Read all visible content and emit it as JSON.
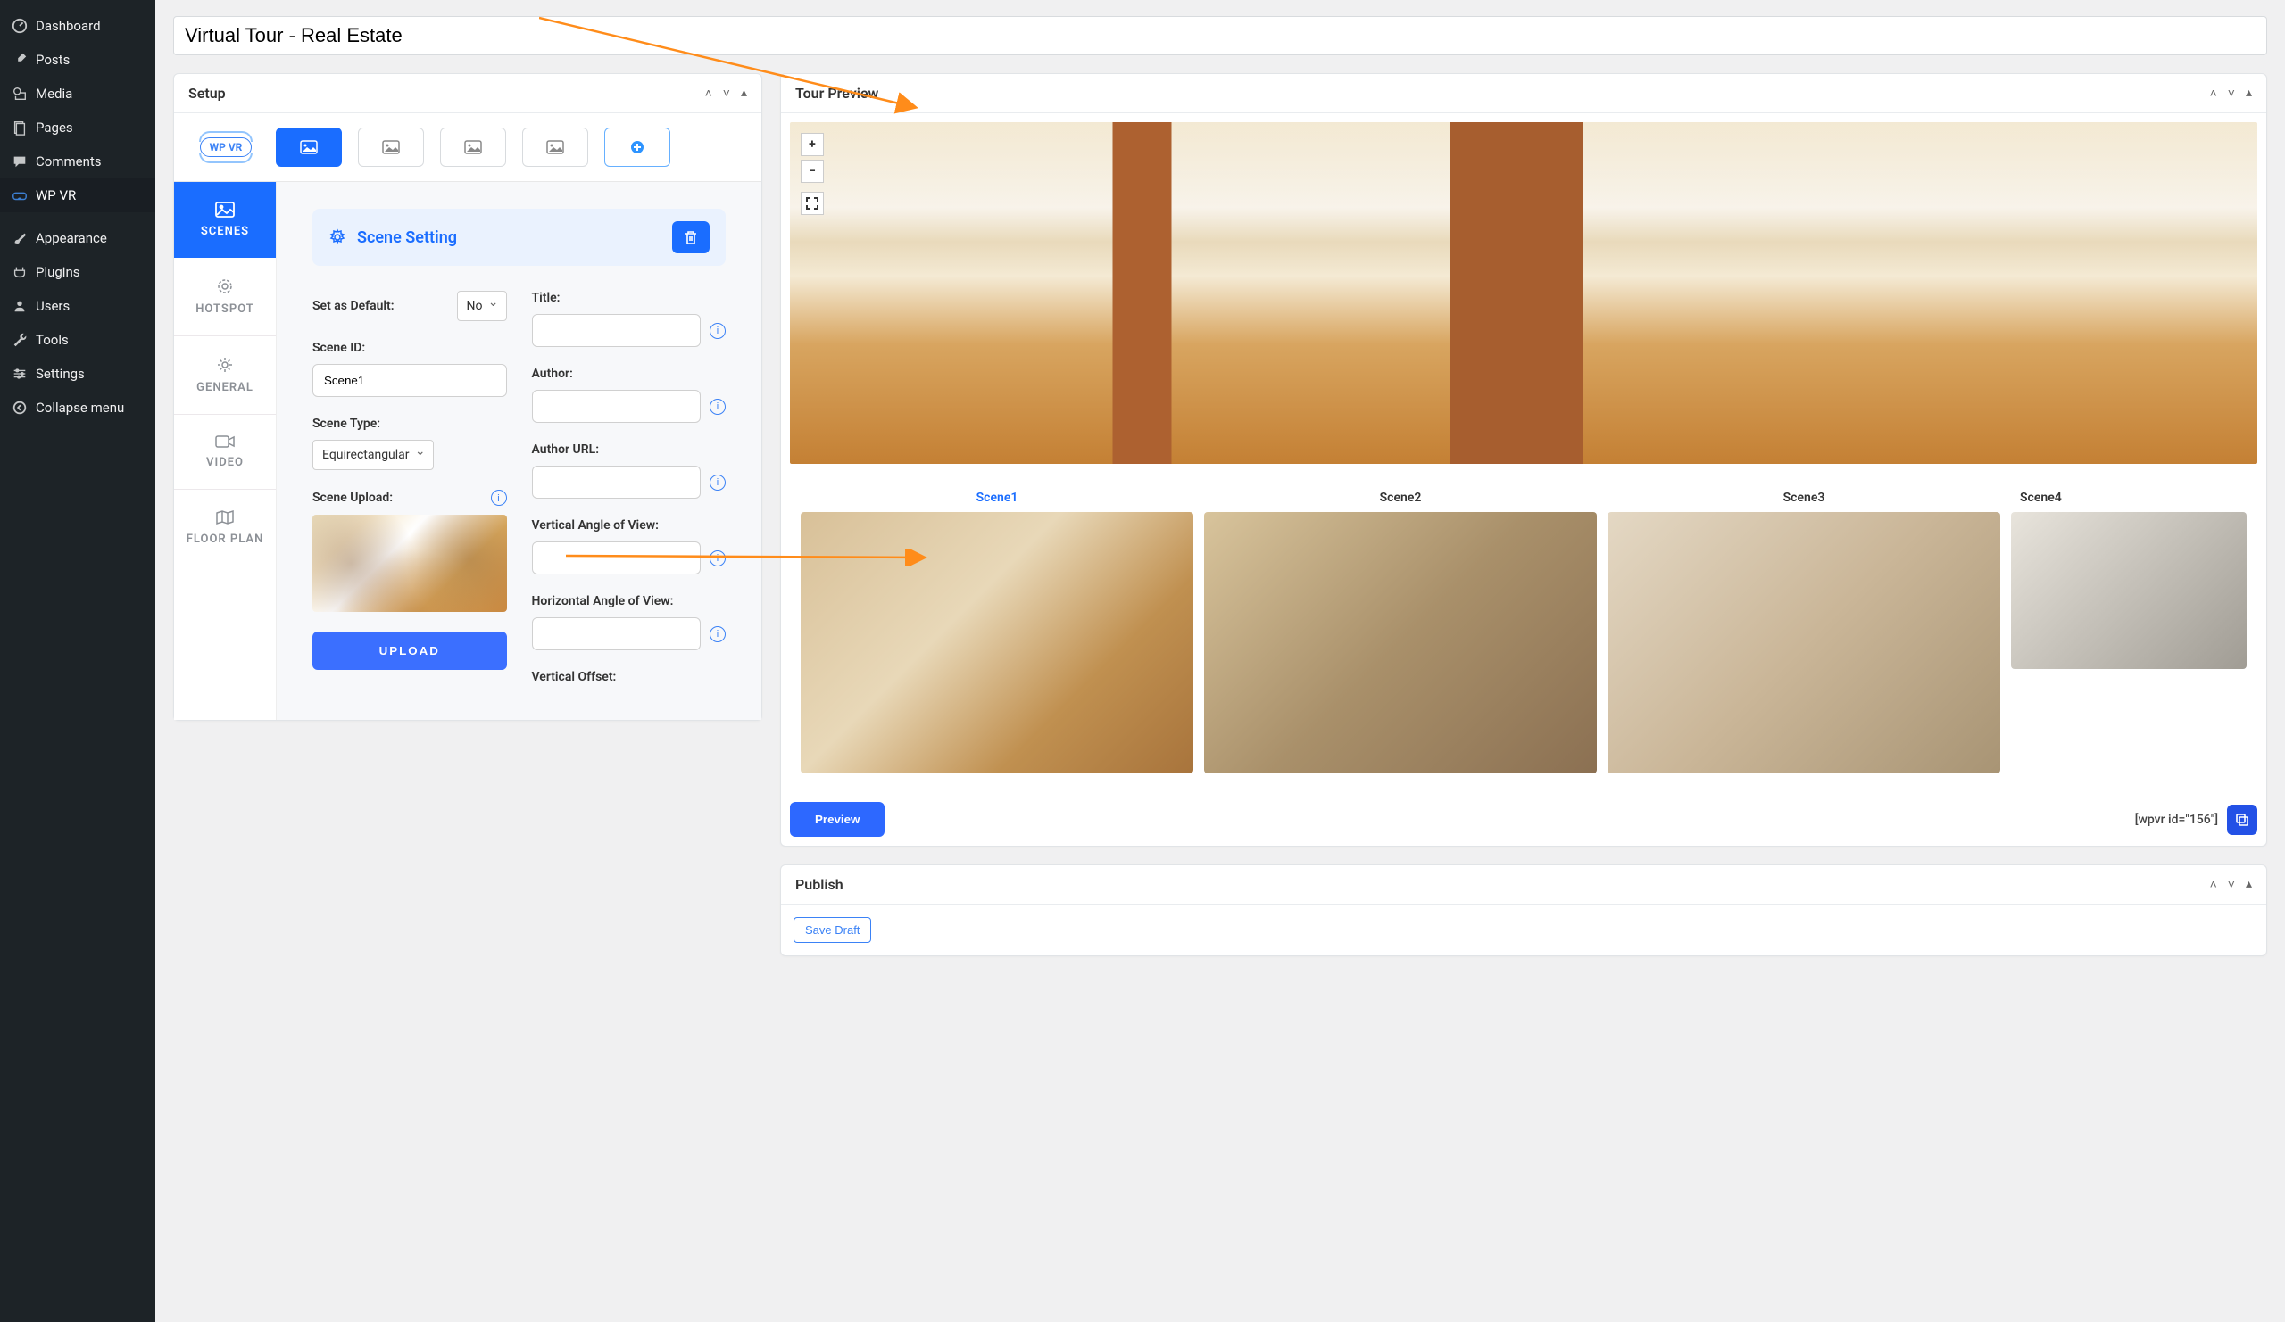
{
  "sidebar": {
    "items": [
      {
        "icon": "dashboard",
        "label": "Dashboard"
      },
      {
        "icon": "pin",
        "label": "Posts"
      },
      {
        "icon": "media",
        "label": "Media"
      },
      {
        "icon": "page",
        "label": "Pages"
      },
      {
        "icon": "comment",
        "label": "Comments"
      },
      {
        "icon": "vr",
        "label": "WP VR",
        "active": true
      },
      {
        "sep": true
      },
      {
        "icon": "appearance",
        "label": "Appearance"
      },
      {
        "icon": "plugin",
        "label": "Plugins"
      },
      {
        "icon": "users",
        "label": "Users"
      },
      {
        "icon": "tools",
        "label": "Tools"
      },
      {
        "icon": "settings",
        "label": "Settings"
      },
      {
        "icon": "collapse",
        "label": "Collapse menu"
      }
    ]
  },
  "page": {
    "title_value": "Virtual Tour - Real Estate"
  },
  "setup": {
    "title": "Setup",
    "logo_text": "WP VR",
    "vtabs": [
      {
        "key": "scenes",
        "label": "SCENES",
        "active": true
      },
      {
        "key": "hotspot",
        "label": "HOTSPOT"
      },
      {
        "key": "general",
        "label": "GENERAL"
      },
      {
        "key": "video",
        "label": "VIDEO"
      },
      {
        "key": "floor",
        "label": "FLOOR PLAN"
      }
    ],
    "scene_setting_label": "Scene Setting",
    "fields": {
      "set_default_label": "Set as Default:",
      "set_default_value": "No",
      "scene_id_label": "Scene ID:",
      "scene_id_value": "Scene1",
      "scene_type_label": "Scene Type:",
      "scene_type_value": "Equirectangular",
      "scene_upload_label": "Scene Upload:",
      "upload_btn": "UPLOAD",
      "title_label": "Title:",
      "author_label": "Author:",
      "author_url_label": "Author URL:",
      "vaov_label": "Vertical Angle of View:",
      "haov_label": "Horizontal Angle of View:",
      "voffset_label": "Vertical Offset:"
    }
  },
  "preview": {
    "title": "Tour Preview",
    "scenes": [
      "Scene1",
      "Scene2",
      "Scene3",
      "Scene4"
    ],
    "active_scene": 0,
    "preview_btn": "Preview",
    "shortcode": "[wpvr id=\"156\"]"
  },
  "publish": {
    "title": "Publish",
    "save_draft": "Save Draft"
  }
}
